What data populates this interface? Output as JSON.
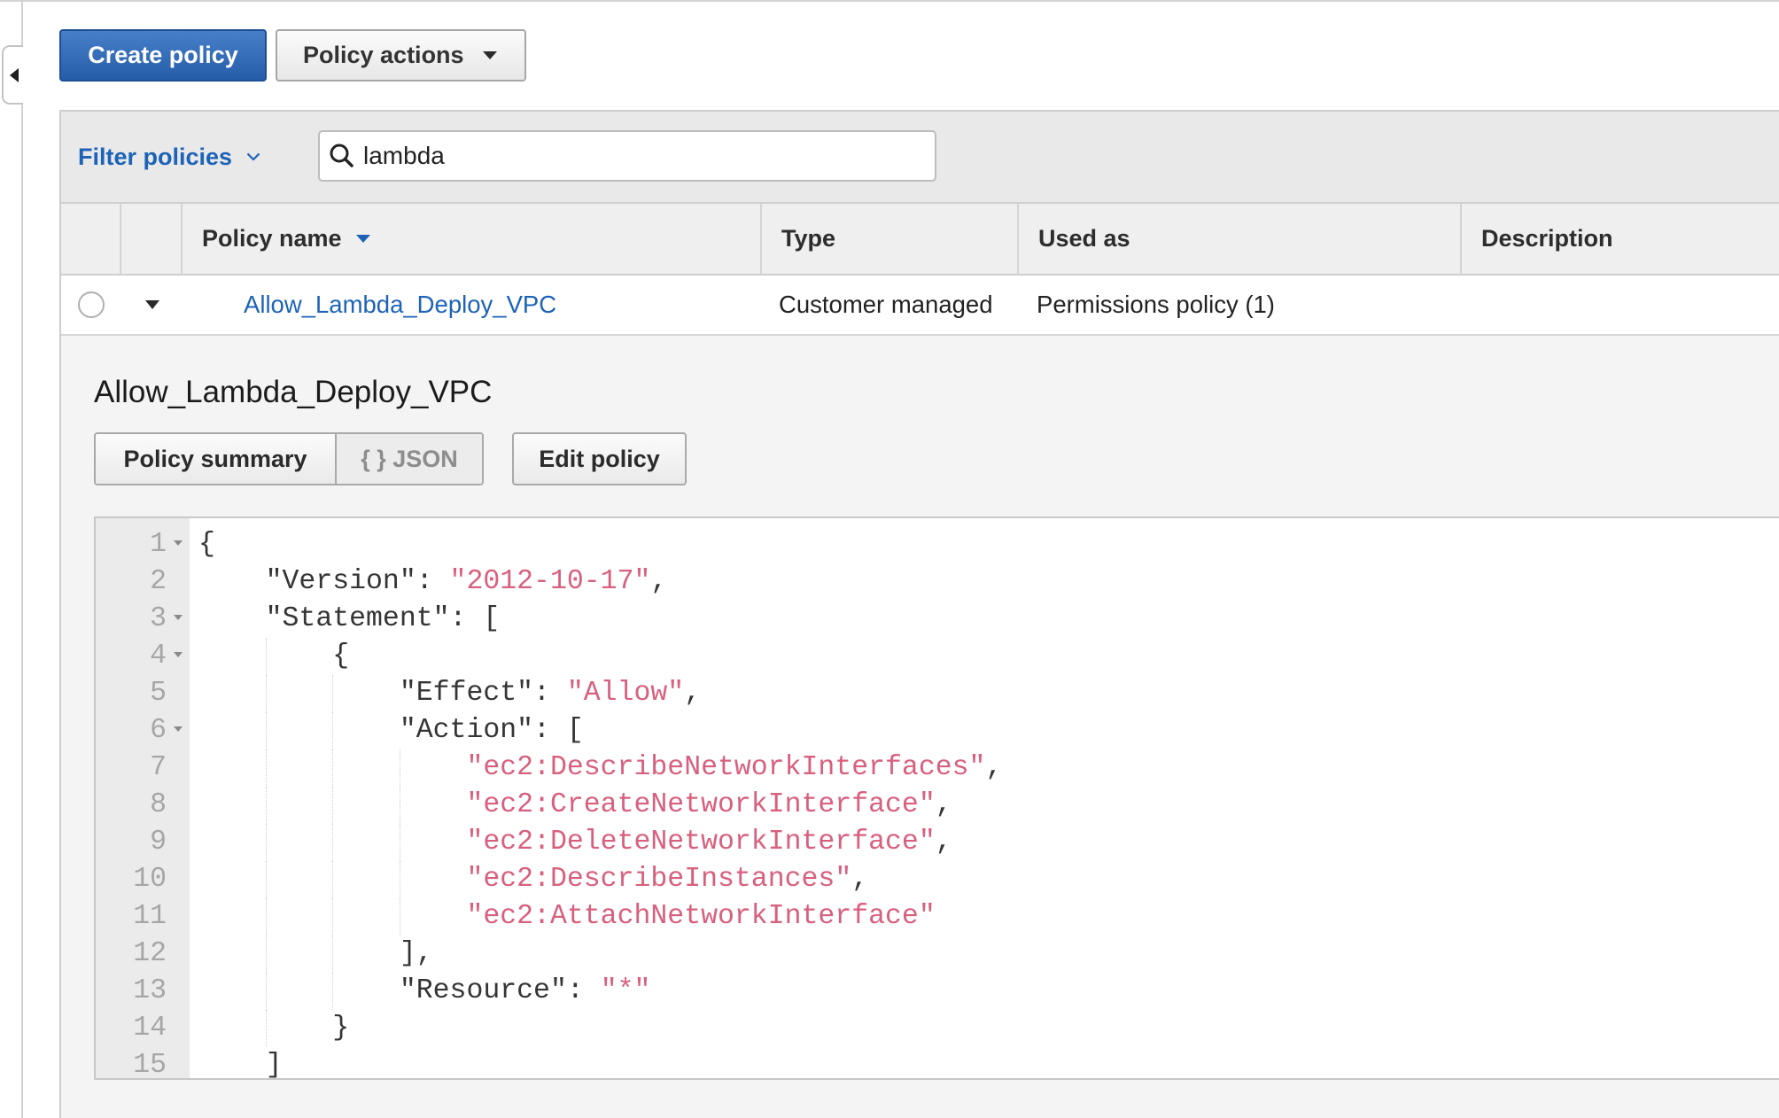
{
  "colors": {
    "accent": "#2a6ac0",
    "link": "#1d63b7",
    "json_string": "#d8607e"
  },
  "toolbar": {
    "create_policy_label": "Create policy",
    "policy_actions_label": "Policy actions"
  },
  "filter": {
    "label": "Filter policies",
    "search_value": "lambda"
  },
  "table": {
    "columns": [
      "Policy name",
      "Type",
      "Used as",
      "Description"
    ],
    "rows": [
      {
        "policy_name": "Allow_Lambda_Deploy_VPC",
        "type": "Customer managed",
        "used_as": "Permissions policy (1)",
        "description": "",
        "selected": false,
        "expanded": true
      }
    ]
  },
  "detail": {
    "title": "Allow_Lambda_Deploy_VPC",
    "tabs": [
      {
        "label": "Policy summary",
        "active": false
      },
      {
        "label": "{ } JSON",
        "active": true
      }
    ],
    "edit_label": "Edit policy"
  },
  "editor": {
    "lines": [
      {
        "number": 1,
        "fold": true,
        "segments": [
          {
            "text": "{"
          }
        ]
      },
      {
        "number": 2,
        "segments": [
          {
            "text": "    \"Version\": "
          },
          {
            "text": "\"2012-10-17\"",
            "string": true
          },
          {
            "text": ","
          }
        ]
      },
      {
        "number": 3,
        "fold": true,
        "segments": [
          {
            "text": "    \"Statement\": ["
          }
        ]
      },
      {
        "number": 4,
        "fold": true,
        "segments": [
          {
            "text": "        {"
          }
        ]
      },
      {
        "number": 5,
        "segments": [
          {
            "text": "            \"Effect\": "
          },
          {
            "text": "\"Allow\"",
            "string": true
          },
          {
            "text": ","
          }
        ]
      },
      {
        "number": 6,
        "fold": true,
        "segments": [
          {
            "text": "            \"Action\": ["
          }
        ]
      },
      {
        "number": 7,
        "segments": [
          {
            "text": "                "
          },
          {
            "text": "\"ec2:DescribeNetworkInterfaces\"",
            "string": true
          },
          {
            "text": ","
          }
        ]
      },
      {
        "number": 8,
        "segments": [
          {
            "text": "                "
          },
          {
            "text": "\"ec2:CreateNetworkInterface\"",
            "string": true
          },
          {
            "text": ","
          }
        ]
      },
      {
        "number": 9,
        "segments": [
          {
            "text": "                "
          },
          {
            "text": "\"ec2:DeleteNetworkInterface\"",
            "string": true
          },
          {
            "text": ","
          }
        ]
      },
      {
        "number": 10,
        "segments": [
          {
            "text": "                "
          },
          {
            "text": "\"ec2:DescribeInstances\"",
            "string": true
          },
          {
            "text": ","
          }
        ]
      },
      {
        "number": 11,
        "segments": [
          {
            "text": "                "
          },
          {
            "text": "\"ec2:AttachNetworkInterface\"",
            "string": true
          }
        ]
      },
      {
        "number": 12,
        "segments": [
          {
            "text": "            ],"
          }
        ]
      },
      {
        "number": 13,
        "segments": [
          {
            "text": "            \"Resource\": "
          },
          {
            "text": "\"*\"",
            "string": true
          }
        ]
      },
      {
        "number": 14,
        "segments": [
          {
            "text": "        }"
          }
        ]
      },
      {
        "number": 15,
        "segments": [
          {
            "text": "    ]"
          }
        ]
      }
    ]
  }
}
